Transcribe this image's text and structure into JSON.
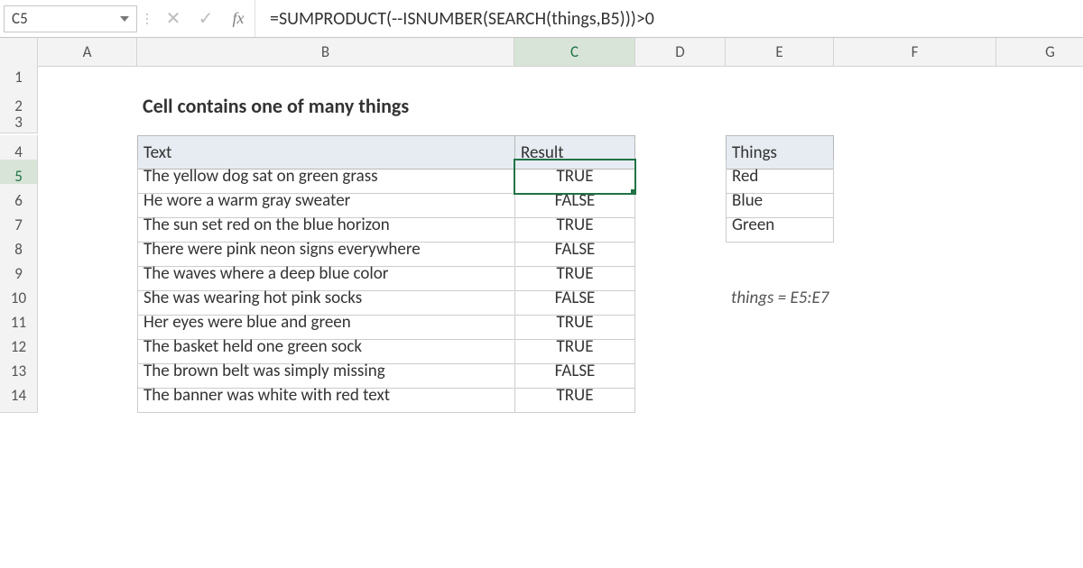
{
  "name_box": "C5",
  "formula": "=SUMPRODUCT(--ISNUMBER(SEARCH(things,B5)))>0",
  "columns": [
    "A",
    "B",
    "C",
    "D",
    "E",
    "F",
    "G"
  ],
  "rows": [
    "1",
    "2",
    "3",
    "4",
    "5",
    "6",
    "7",
    "8",
    "9",
    "10",
    "11",
    "12",
    "13",
    "14"
  ],
  "selected_col": "C",
  "selected_row": "5",
  "title": "Cell contains one of many things",
  "table": {
    "headers": {
      "text": "Text",
      "result": "Result"
    },
    "rows": [
      {
        "text": "The yellow dog sat on green grass",
        "result": "TRUE"
      },
      {
        "text": "He wore a warm gray sweater",
        "result": "FALSE"
      },
      {
        "text": "The sun set red on the blue horizon",
        "result": "TRUE"
      },
      {
        "text": "There were pink neon signs everywhere",
        "result": "FALSE"
      },
      {
        "text": "The waves where a deep blue color",
        "result": "TRUE"
      },
      {
        "text": "She was wearing hot pink socks",
        "result": "FALSE"
      },
      {
        "text": "Her eyes were blue and green",
        "result": "TRUE"
      },
      {
        "text": "The basket held one green sock",
        "result": "TRUE"
      },
      {
        "text": "The brown belt was simply missing",
        "result": "FALSE"
      },
      {
        "text": "The banner was white with red text",
        "result": "TRUE"
      }
    ]
  },
  "things": {
    "header": "Things",
    "items": [
      "Red",
      "Blue",
      "Green"
    ]
  },
  "note": "things = E5:E7"
}
